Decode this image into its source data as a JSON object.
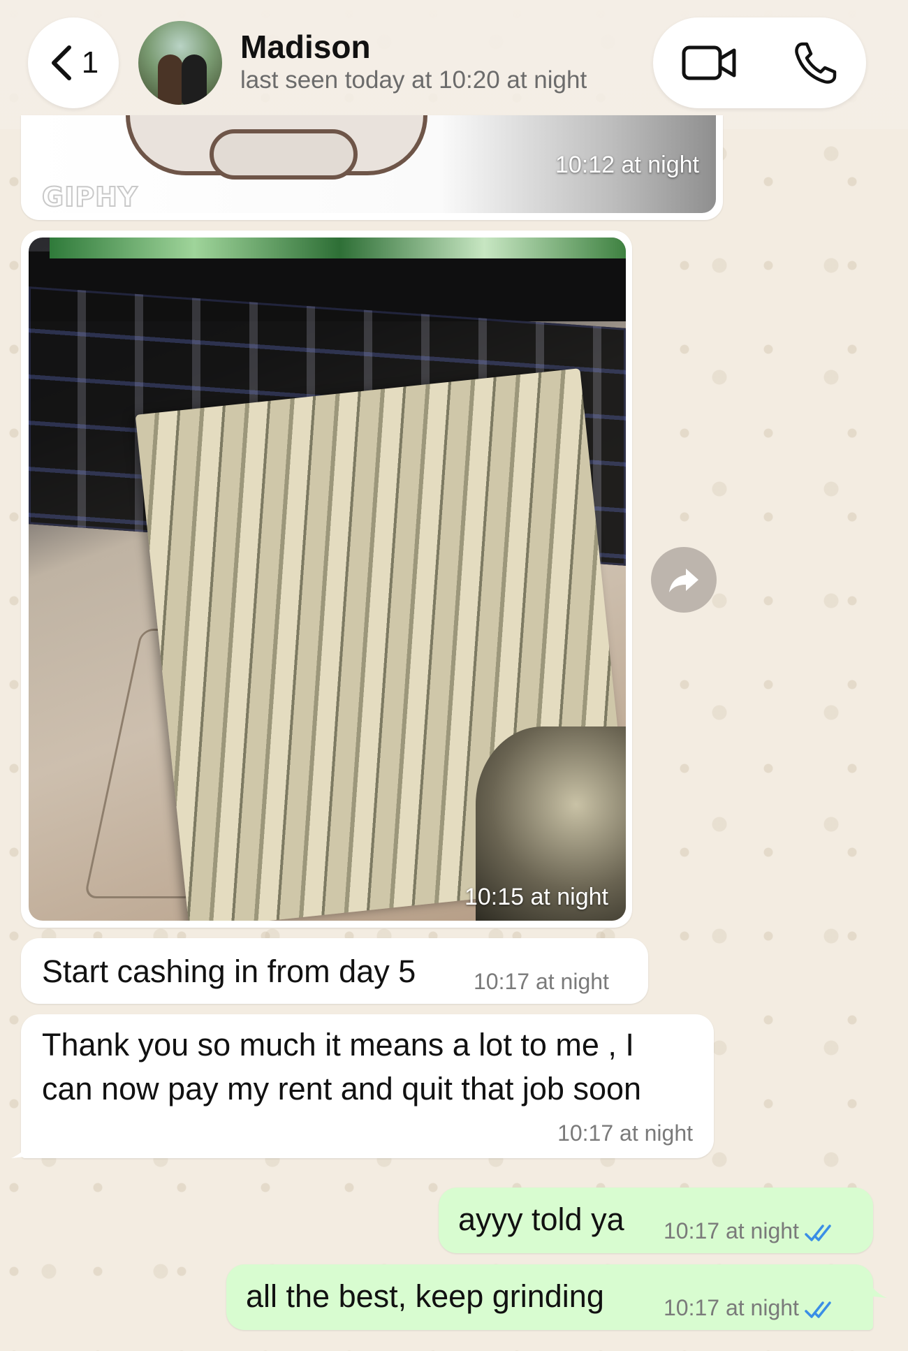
{
  "header": {
    "back_count": "1",
    "contact_name": "Madison",
    "status": "last seen today at 10:20 at night",
    "icons": [
      "chevron-left-icon",
      "video-call-icon",
      "phone-call-icon"
    ]
  },
  "messages": [
    {
      "type": "gif",
      "direction": "incoming",
      "watermark": "GIPHY",
      "time": "10:12 at night"
    },
    {
      "type": "image",
      "direction": "incoming",
      "time": "10:15 at night"
    },
    {
      "type": "text",
      "direction": "incoming",
      "text": "Start cashing in from day 5",
      "time": "10:17 at night"
    },
    {
      "type": "text",
      "direction": "incoming",
      "lines": [
        "Thank you so much it means a lot to me , I",
        "can now pay my rent and quit that job soon"
      ],
      "time": "10:17 at night"
    },
    {
      "type": "text",
      "direction": "outgoing",
      "text": "ayyy told ya",
      "time": "10:17 at night",
      "status": "read"
    },
    {
      "type": "text",
      "direction": "outgoing",
      "text": "all the best, keep grinding",
      "time": "10:17 at night",
      "status": "read"
    }
  ],
  "colors": {
    "outgoing_bubble": "#d8fcd0",
    "incoming_bubble": "#ffffff",
    "read_ticks": "#3a8ee6",
    "wallpaper": "#f3ece1"
  }
}
